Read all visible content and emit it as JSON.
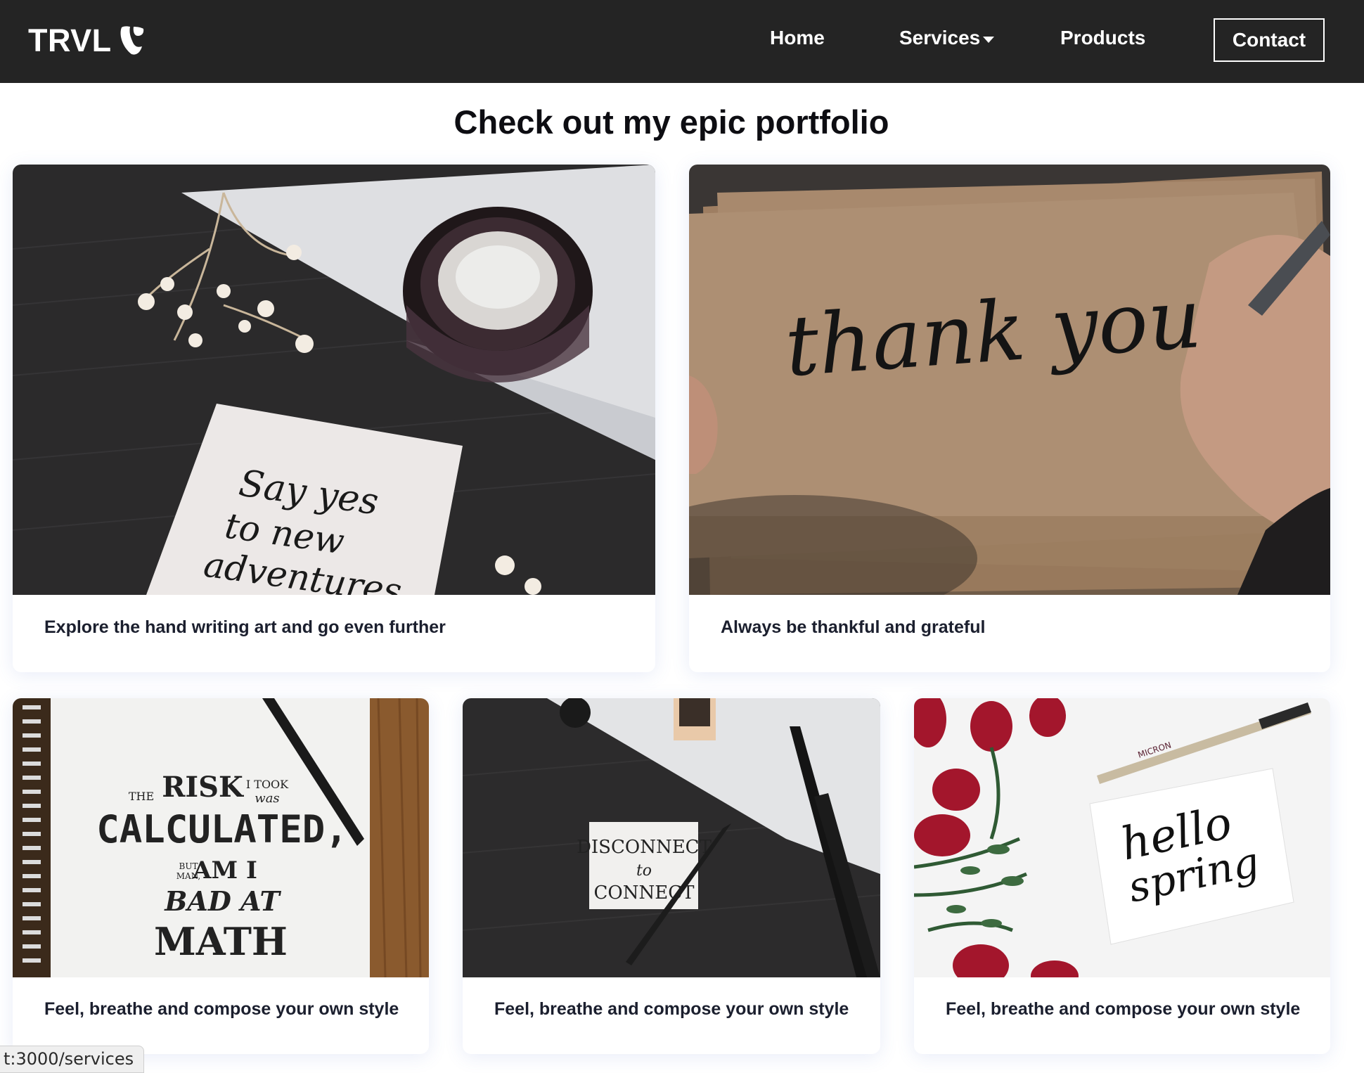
{
  "header": {
    "logo_text": "TRVL",
    "nav": {
      "home": "Home",
      "services": "Services",
      "products": "Products",
      "contact": "Contact"
    }
  },
  "main": {
    "title": "Check out my epic portfolio",
    "cards": [
      {
        "caption": "Explore the hand writing art and go even further",
        "image_text": [
          "Say yes",
          "to new",
          "adventures"
        ]
      },
      {
        "caption": "Always be thankful and grateful",
        "image_text": [
          "thank you"
        ]
      },
      {
        "caption": "Feel, breathe and compose your own style",
        "image_text": [
          "THE",
          "RISK",
          "I TOOK",
          "was",
          "CALCULATED,",
          "BUT",
          "MAN,",
          "AM I",
          "BAD AT",
          "MATH"
        ]
      },
      {
        "caption": "Feel, breathe and compose your own style",
        "image_text": [
          "DISCONNECT",
          "to",
          "CONNECT"
        ]
      },
      {
        "caption": "Feel, breathe and compose your own style",
        "image_text": [
          "hello",
          "spring",
          "MICRON"
        ]
      }
    ]
  },
  "status_bar": {
    "url": "t:3000/services"
  },
  "colors": {
    "header_bg": "#242424",
    "text_dark": "#1b1f2e",
    "card_shadow": "#506ec8"
  }
}
